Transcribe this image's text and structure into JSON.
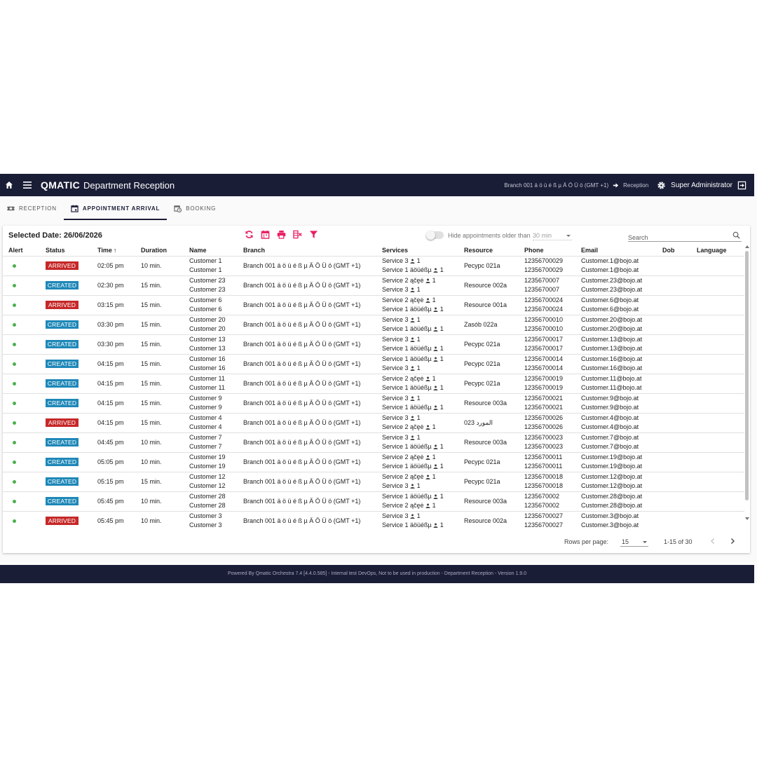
{
  "header": {
    "logo": "QMATIC",
    "title": "Department Reception",
    "branch": "Branch 001 ä ö ü é ß µ Ä Ö Ü ö (GMT +1)",
    "location": "Reception",
    "user": "Super Administrator"
  },
  "tabs": [
    {
      "label": "RECEPTION"
    },
    {
      "label": "APPOINTMENT ARRIVAL"
    },
    {
      "label": "BOOKING"
    }
  ],
  "toolbar": {
    "selected_date": "Selected Date: 26/06/2026",
    "hide_label": "Hide appointments older than",
    "hide_value": "30 min",
    "search_placeholder": "Search"
  },
  "columns": [
    "Alert",
    "Status",
    "Time",
    "Duration",
    "Name",
    "Branch",
    "Services",
    "Resource",
    "Phone",
    "Email",
    "Dob",
    "Language"
  ],
  "rows": [
    {
      "status": "ARRIVED",
      "time": "02:05 pm",
      "duration": "10 min.",
      "name1": "Customer 1",
      "name2": "Customer 1",
      "branch": "Branch 001 ä ö ü é ß µ Ä Ö Ü ö (GMT +1)",
      "svc1": "Service 3",
      "svc1n": "1",
      "svc2": "Service 1 äöüéßµ",
      "svc2n": "1",
      "resource": "Ресурс 021a",
      "phone1": "12356700029",
      "phone2": "12356700029",
      "email1": "Customer.1@bojo.at",
      "email2": "Customer.1@bojo.at"
    },
    {
      "status": "CREATED",
      "time": "02:30 pm",
      "duration": "15 min.",
      "name1": "Customer 23",
      "name2": "Customer 23",
      "branch": "Branch 001 ä ö ü é ß µ Ä Ö Ü ö (GMT +1)",
      "svc1": "Service 2 ąčęė",
      "svc1n": "1",
      "svc2": "Service 3",
      "svc2n": "1",
      "resource": "Resource 002a",
      "phone1": "1235670007",
      "phone2": "1235670007",
      "email1": "Customer.23@bojo.at",
      "email2": "Customer.23@bojo.at"
    },
    {
      "status": "ARRIVED",
      "time": "03:15 pm",
      "duration": "15 min.",
      "name1": "Customer 6",
      "name2": "Customer 6",
      "branch": "Branch 001 ä ö ü é ß µ Ä Ö Ü ö (GMT +1)",
      "svc1": "Service 2 ąčęė",
      "svc1n": "1",
      "svc2": "Service 1 äöüéßµ",
      "svc2n": "1",
      "resource": "Resource 001a",
      "phone1": "12356700024",
      "phone2": "12356700024",
      "email1": "Customer.6@bojo.at",
      "email2": "Customer.6@bojo.at"
    },
    {
      "status": "CREATED",
      "time": "03:30 pm",
      "duration": "15 min.",
      "name1": "Customer 20",
      "name2": "Customer 20",
      "branch": "Branch 001 ä ö ü é ß µ Ä Ö Ü ö (GMT +1)",
      "svc1": "Service 3",
      "svc1n": "1",
      "svc2": "Service 1 äöüéßµ",
      "svc2n": "1",
      "resource": "Zasób 022a",
      "phone1": "12356700010",
      "phone2": "12356700010",
      "email1": "Customer.20@bojo.at",
      "email2": "Customer.20@bojo.at"
    },
    {
      "status": "CREATED",
      "time": "03:30 pm",
      "duration": "15 min.",
      "name1": "Customer 13",
      "name2": "Customer 13",
      "branch": "Branch 001 ä ö ü é ß µ Ä Ö Ü ö (GMT +1)",
      "svc1": "Service 3",
      "svc1n": "1",
      "svc2": "Service 1 äöüéßµ",
      "svc2n": "1",
      "resource": "Ресурс 021a",
      "phone1": "12356700017",
      "phone2": "12356700017",
      "email1": "Customer.13@bojo.at",
      "email2": "Customer.13@bojo.at"
    },
    {
      "status": "CREATED",
      "time": "04:15 pm",
      "duration": "15 min.",
      "name1": "Customer 16",
      "name2": "Customer 16",
      "branch": "Branch 001 ä ö ü é ß µ Ä Ö Ü ö (GMT +1)",
      "svc1": "Service 1 äöüéßµ",
      "svc1n": "1",
      "svc2": "Service 3",
      "svc2n": "1",
      "resource": "Ресурс 021a",
      "phone1": "12356700014",
      "phone2": "12356700014",
      "email1": "Customer.16@bojo.at",
      "email2": "Customer.16@bojo.at"
    },
    {
      "status": "CREATED",
      "time": "04:15 pm",
      "duration": "15 min.",
      "name1": "Customer 11",
      "name2": "Customer 11",
      "branch": "Branch 001 ä ö ü é ß µ Ä Ö Ü ö (GMT +1)",
      "svc1": "Service 2 ąčęė",
      "svc1n": "1",
      "svc2": "Service 1 äöüéßµ",
      "svc2n": "1",
      "resource": "Ресурс 021a",
      "phone1": "12356700019",
      "phone2": "12356700019",
      "email1": "Customer.11@bojo.at",
      "email2": "Customer.11@bojo.at"
    },
    {
      "status": "CREATED",
      "time": "04:15 pm",
      "duration": "15 min.",
      "name1": "Customer 9",
      "name2": "Customer 9",
      "branch": "Branch 001 ä ö ü é ß µ Ä Ö Ü ö (GMT +1)",
      "svc1": "Service 3",
      "svc1n": "1",
      "svc2": "Service 1 äöüéßµ",
      "svc2n": "1",
      "resource": "Resource 003a",
      "phone1": "12356700021",
      "phone2": "12356700021",
      "email1": "Customer.9@bojo.at",
      "email2": "Customer.9@bojo.at"
    },
    {
      "status": "ARRIVED",
      "time": "04:15 pm",
      "duration": "15 min.",
      "name1": "Customer 4",
      "name2": "Customer 4",
      "branch": "Branch 001 ä ö ü é ß µ Ä Ö Ü ö (GMT +1)",
      "svc1": "Service 3",
      "svc1n": "1",
      "svc2": "Service 2 ąčęė",
      "svc2n": "1",
      "resource": "المورد 023",
      "phone1": "12356700026",
      "phone2": "12356700026",
      "email1": "Customer.4@bojo.at",
      "email2": "Customer.4@bojo.at"
    },
    {
      "status": "CREATED",
      "time": "04:45 pm",
      "duration": "10 min.",
      "name1": "Customer 7",
      "name2": "Customer 7",
      "branch": "Branch 001 ä ö ü é ß µ Ä Ö Ü ö (GMT +1)",
      "svc1": "Service 3",
      "svc1n": "1",
      "svc2": "Service 1 äöüéßµ",
      "svc2n": "1",
      "resource": "Resource 003a",
      "phone1": "12356700023",
      "phone2": "12356700023",
      "email1": "Customer.7@bojo.at",
      "email2": "Customer.7@bojo.at"
    },
    {
      "status": "CREATED",
      "time": "05:05 pm",
      "duration": "10 min.",
      "name1": "Customer 19",
      "name2": "Customer 19",
      "branch": "Branch 001 ä ö ü é ß µ Ä Ö Ü ö (GMT +1)",
      "svc1": "Service 2 ąčęė",
      "svc1n": "1",
      "svc2": "Service 1 äöüéßµ",
      "svc2n": "1",
      "resource": "Ресурс 021a",
      "phone1": "12356700011",
      "phone2": "12356700011",
      "email1": "Customer.19@bojo.at",
      "email2": "Customer.19@bojo.at"
    },
    {
      "status": "CREATED",
      "time": "05:15 pm",
      "duration": "15 min.",
      "name1": "Customer 12",
      "name2": "Customer 12",
      "branch": "Branch 001 ä ö ü é ß µ Ä Ö Ü ö (GMT +1)",
      "svc1": "Service 2 ąčęė",
      "svc1n": "1",
      "svc2": "Service 3",
      "svc2n": "1",
      "resource": "Ресурс 021a",
      "phone1": "12356700018",
      "phone2": "12356700018",
      "email1": "Customer.12@bojo.at",
      "email2": "Customer.12@bojo.at"
    },
    {
      "status": "CREATED",
      "time": "05:45 pm",
      "duration": "10 min.",
      "name1": "Customer 28",
      "name2": "Customer 28",
      "branch": "Branch 001 ä ö ü é ß µ Ä Ö Ü ö (GMT +1)",
      "svc1": "Service 1 äöüéßµ",
      "svc1n": "1",
      "svc2": "Service 2 ąčęė",
      "svc2n": "1",
      "resource": "Resource 003a",
      "phone1": "1235670002",
      "phone2": "1235670002",
      "email1": "Customer.28@bojo.at",
      "email2": "Customer.28@bojo.at"
    },
    {
      "status": "ARRIVED",
      "time": "05:45 pm",
      "duration": "10 min.",
      "name1": "Customer 3",
      "name2": "Customer 3",
      "branch": "Branch 001 ä ö ü é ß µ Ä Ö Ü ö (GMT +1)",
      "svc1": "Service 3",
      "svc1n": "1",
      "svc2": "Service 1 äöüéßµ",
      "svc2n": "1",
      "resource": "Resource 002a",
      "phone1": "12356700027",
      "phone2": "12356700027",
      "email1": "Customer.3@bojo.at",
      "email2": "Customer.3@bojo.at"
    }
  ],
  "pagination": {
    "rows_label": "Rows per page:",
    "rows_value": "15",
    "range": "1-15 of 30"
  },
  "footer": "Powered By Qmatic Orchestra 7.4 [4.4.0.585] - Internal test DevOps, Not to be used in production - Department Reception - Version 1.9.0",
  "colors": {
    "navy": "#1a1d36",
    "arrived": "#c62828",
    "created": "#1e88b8",
    "alert_dot": "#4caf50",
    "action_icon": "#e91e63"
  }
}
